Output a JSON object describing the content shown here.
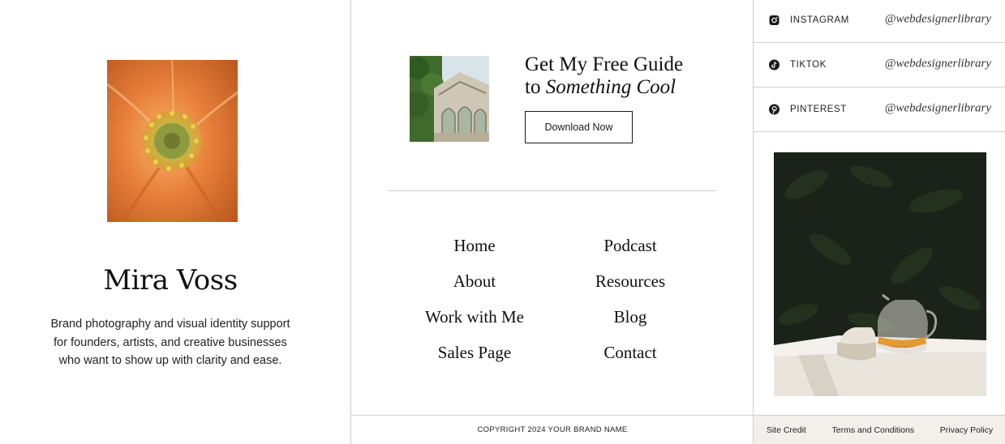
{
  "profile": {
    "name": "Mira Voss",
    "bio": "Brand photography and visual identity support for founders, artists, and creative businesses who want to show up with clarity and ease."
  },
  "guide": {
    "title_line1": "Get My Free Guide",
    "title_line2_prefix": "to ",
    "title_line2_italic": "Something Cool",
    "button_label": "Download Now"
  },
  "nav": {
    "left": [
      "Home",
      "About",
      "Work with Me",
      "Sales Page"
    ],
    "right": [
      "Podcast",
      "Resources",
      "Blog",
      "Contact"
    ]
  },
  "social": [
    {
      "label": "INSTAGRAM",
      "handle": "@webdesignerlibrary",
      "icon": "instagram-icon"
    },
    {
      "label": "TIKTOK",
      "handle": "@webdesignerlibrary",
      "icon": "tiktok-icon"
    },
    {
      "label": "PINTEREST",
      "handle": "@webdesignerlibrary",
      "icon": "pinterest-icon"
    }
  ],
  "footer": {
    "copyright": "COPYRIGHT 2024 YOUR BRAND NAME",
    "links": [
      "Site Credit",
      "Terms and Conditions",
      "Privacy Policy"
    ]
  },
  "colors": {
    "footer_bg": "#f3f0ec",
    "divider": "#cfcfcf",
    "text": "#1a1a1a"
  }
}
